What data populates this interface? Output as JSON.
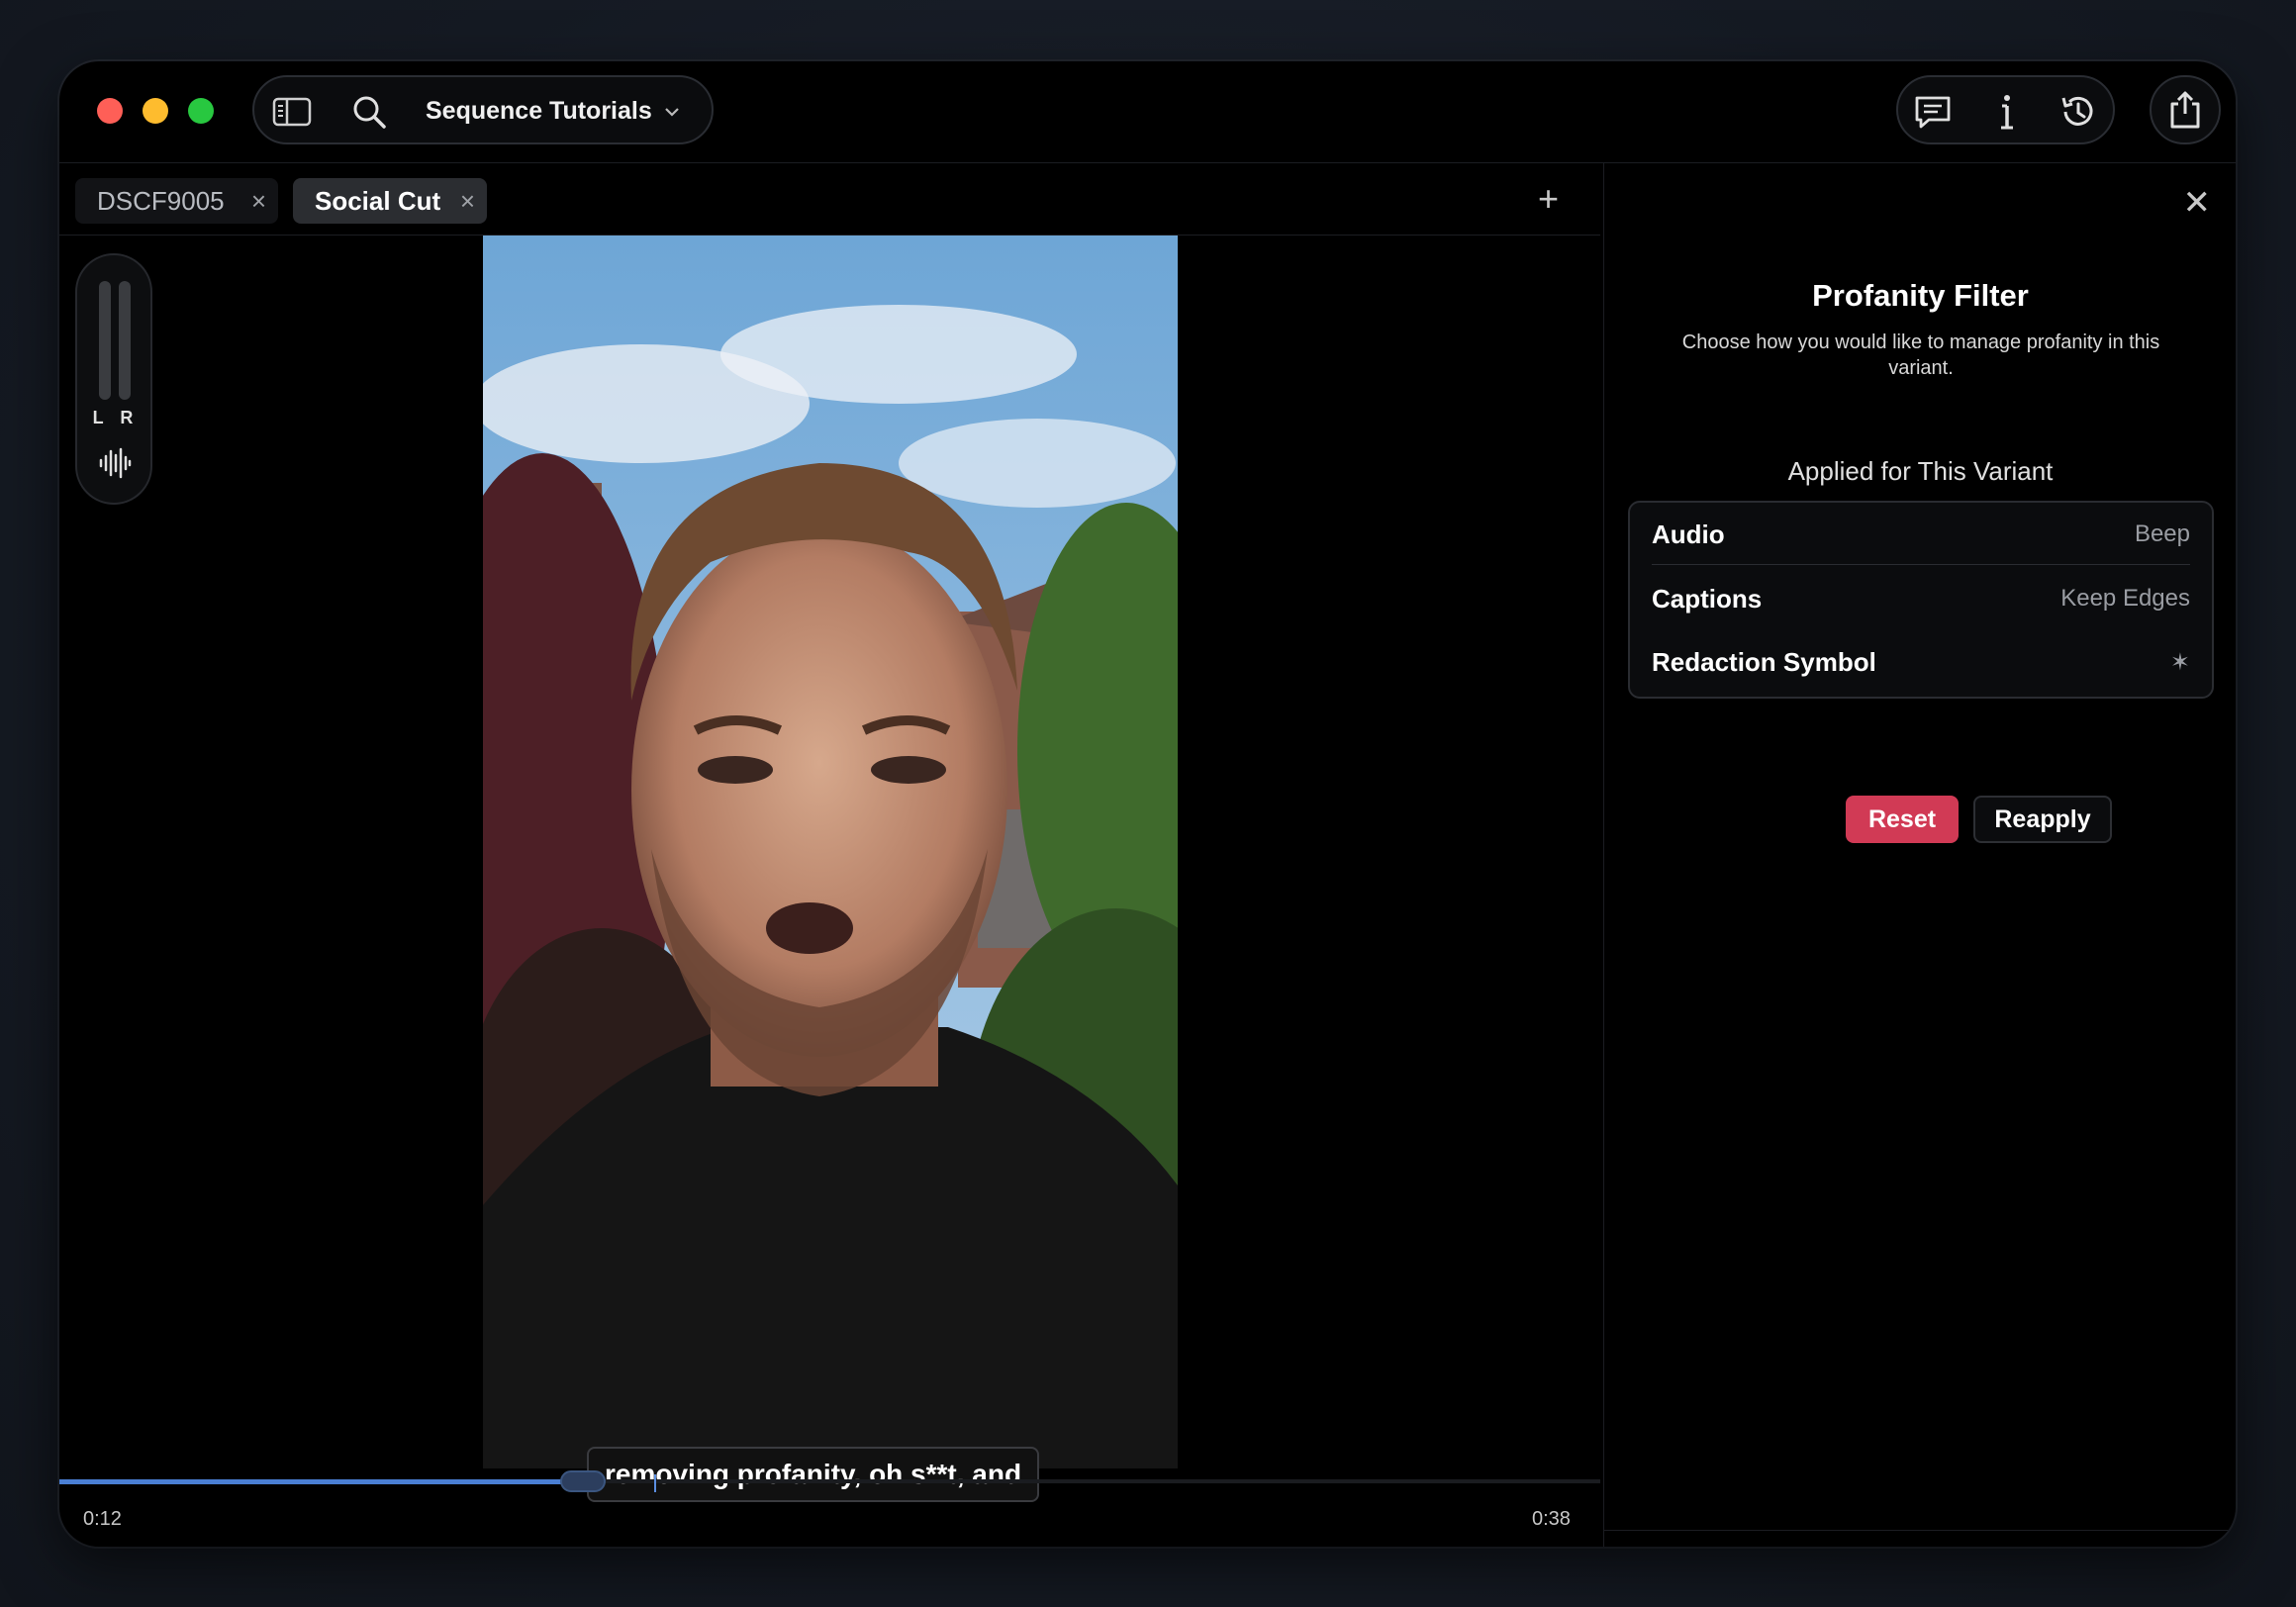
{
  "titlebar": {
    "project_title": "Sequence Tutorials"
  },
  "tabs": [
    {
      "label": "DSCF9005",
      "active": false
    },
    {
      "label": "Social Cut",
      "active": true
    }
  ],
  "meter": {
    "label": "L R"
  },
  "caption": {
    "text": "removing profanity, oh s**t, and"
  },
  "timeline": {
    "current_time": "0:12",
    "duration": "0:38",
    "progress_fraction": 0.34
  },
  "panel": {
    "title": "Profanity Filter",
    "description": "Choose how you would like to manage profanity in this variant.",
    "subheading": "Applied for This Variant",
    "settings": [
      {
        "label": "Audio",
        "value": "Beep"
      },
      {
        "label": "Captions",
        "value": "Keep Edges"
      },
      {
        "label": "Redaction Symbol",
        "value": "✶"
      }
    ],
    "reset_label": "Reset",
    "reapply_label": "Reapply"
  },
  "colors": {
    "accent_red": "#d13a55",
    "progress_blue": "#4a7fd4",
    "traffic_red": "#fe5f57",
    "traffic_yellow": "#febc2e",
    "traffic_green": "#28c840"
  }
}
